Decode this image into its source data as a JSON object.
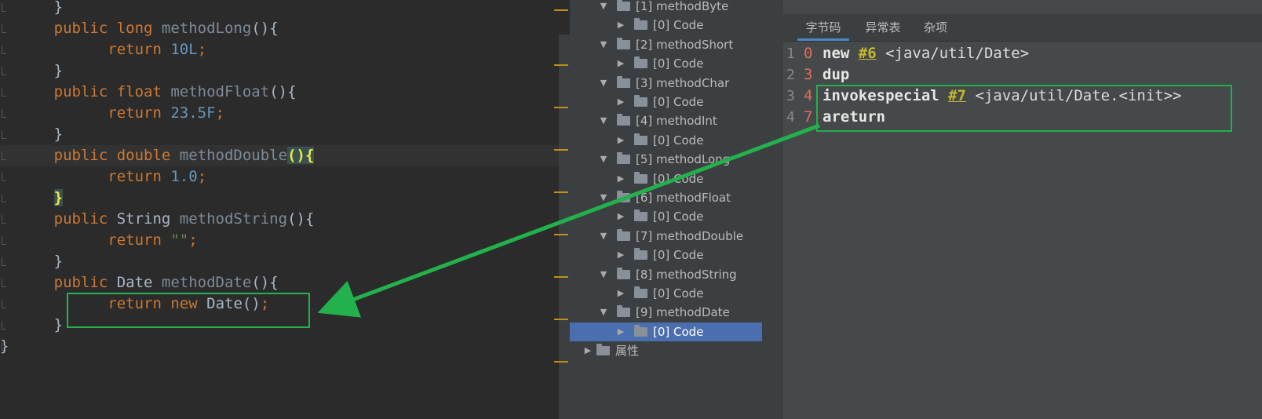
{
  "editor": {
    "lines": [
      {
        "id": "l1",
        "indent": "    ",
        "tokens": [
          {
            "t": "}",
            "c": ""
          }
        ]
      },
      {
        "id": "l2",
        "indent": "    ",
        "tokens": [
          {
            "t": "public long ",
            "c": "kw"
          },
          {
            "t": "methodLong",
            "c": "fn"
          },
          {
            "t": "(){",
            "c": ""
          }
        ]
      },
      {
        "id": "l3",
        "indent": "        ",
        "tokens": [
          {
            "t": "return ",
            "c": "kw"
          },
          {
            "t": "10L",
            "c": "num"
          },
          {
            "t": ";",
            "c": "kw"
          }
        ]
      },
      {
        "id": "l4",
        "indent": "    ",
        "tokens": [
          {
            "t": "}",
            "c": ""
          }
        ]
      },
      {
        "id": "l5",
        "indent": "    ",
        "tokens": [
          {
            "t": "public float ",
            "c": "kw"
          },
          {
            "t": "methodFloat",
            "c": "fn"
          },
          {
            "t": "(){",
            "c": ""
          }
        ]
      },
      {
        "id": "l6",
        "indent": "        ",
        "tokens": [
          {
            "t": "return ",
            "c": "kw"
          },
          {
            "t": "23.5F",
            "c": "num"
          },
          {
            "t": ";",
            "c": "kw"
          }
        ]
      },
      {
        "id": "l7",
        "indent": "    ",
        "tokens": [
          {
            "t": "}",
            "c": ""
          }
        ]
      },
      {
        "id": "l8",
        "indent": "    ",
        "tokens": [
          {
            "t": "public double ",
            "c": "kw"
          },
          {
            "t": "methodDouble",
            "c": "fn"
          },
          {
            "t": "()",
            "c": "br-hl"
          },
          {
            "t": "{",
            "c": "br-hl"
          }
        ],
        "current": true
      },
      {
        "id": "l9",
        "indent": "        ",
        "tokens": [
          {
            "t": "return ",
            "c": "kw"
          },
          {
            "t": "1.0",
            "c": "num"
          },
          {
            "t": ";",
            "c": "kw"
          }
        ]
      },
      {
        "id": "l10",
        "indent": "    ",
        "tokens": [
          {
            "t": "}",
            "c": "br-hl"
          }
        ]
      },
      {
        "id": "l11",
        "indent": "    ",
        "tokens": [
          {
            "t": "public ",
            "c": "kw"
          },
          {
            "t": "String ",
            "c": ""
          },
          {
            "t": "methodString",
            "c": "fn"
          },
          {
            "t": "(){",
            "c": ""
          }
        ]
      },
      {
        "id": "l12",
        "indent": "        ",
        "tokens": [
          {
            "t": "return ",
            "c": "kw"
          },
          {
            "t": "\"\"",
            "c": "str"
          },
          {
            "t": ";",
            "c": "kw"
          }
        ]
      },
      {
        "id": "l13",
        "indent": "    ",
        "tokens": [
          {
            "t": "}",
            "c": ""
          }
        ]
      },
      {
        "id": "l14",
        "indent": "    ",
        "tokens": [
          {
            "t": "public ",
            "c": "kw"
          },
          {
            "t": "Date ",
            "c": ""
          },
          {
            "t": "methodDate",
            "c": "fn"
          },
          {
            "t": "(){",
            "c": ""
          }
        ]
      },
      {
        "id": "l15",
        "indent": "        ",
        "tokens": [
          {
            "t": "return new ",
            "c": "kw"
          },
          {
            "t": "Date()",
            "c": ""
          },
          {
            "t": ";",
            "c": "kw"
          }
        ]
      },
      {
        "id": "l16",
        "indent": "    ",
        "tokens": [
          {
            "t": "}",
            "c": ""
          }
        ]
      },
      {
        "id": "l17",
        "indent": "",
        "tokens": [
          {
            "t": "}",
            "c": ""
          }
        ]
      }
    ]
  },
  "tree": {
    "items": [
      {
        "label": "[1] methodByte",
        "level": 1,
        "expanded": true
      },
      {
        "label": "[0] Code",
        "level": 2,
        "expanded": false
      },
      {
        "label": "[2] methodShort",
        "level": 1,
        "expanded": true
      },
      {
        "label": "[0] Code",
        "level": 2,
        "expanded": false
      },
      {
        "label": "[3] methodChar",
        "level": 1,
        "expanded": true
      },
      {
        "label": "[0] Code",
        "level": 2,
        "expanded": false
      },
      {
        "label": "[4] methodInt",
        "level": 1,
        "expanded": true
      },
      {
        "label": "[0] Code",
        "level": 2,
        "expanded": false
      },
      {
        "label": "[5] methodLong",
        "level": 1,
        "expanded": true
      },
      {
        "label": "[0] Code",
        "level": 2,
        "expanded": false
      },
      {
        "label": "[6] methodFloat",
        "level": 1,
        "expanded": true
      },
      {
        "label": "[0] Code",
        "level": 2,
        "expanded": false
      },
      {
        "label": "[7] methodDouble",
        "level": 1,
        "expanded": true
      },
      {
        "label": "[0] Code",
        "level": 2,
        "expanded": false
      },
      {
        "label": "[8] methodString",
        "level": 1,
        "expanded": true
      },
      {
        "label": "[0] Code",
        "level": 2,
        "expanded": false
      },
      {
        "label": "[9] methodDate",
        "level": 1,
        "expanded": true
      },
      {
        "label": "[0] Code",
        "level": 2,
        "expanded": false,
        "selected": true
      },
      {
        "label": "属性",
        "level": 0,
        "expanded": false
      }
    ]
  },
  "tabs": [
    "字节码",
    "异常表",
    "杂项"
  ],
  "bytecode": {
    "lines": [
      {
        "num": "1",
        "offset": "0",
        "op": "new",
        "ref": "#6",
        "rest": " <java/util/Date>"
      },
      {
        "num": "2",
        "offset": "3",
        "op": "dup",
        "ref": "",
        "rest": ""
      },
      {
        "num": "3",
        "offset": "4",
        "op": "invokespecial",
        "ref": "#7",
        "rest": " <java/util/Date.<init>>"
      },
      {
        "num": "4",
        "offset": "7",
        "op": "areturn",
        "ref": "",
        "rest": ""
      }
    ]
  },
  "colors": {
    "annotation": "#22b14c",
    "selection": "#4b6eaf",
    "keyword": "#cc7832",
    "number": "#6897bb"
  },
  "icons": {
    "folder": "folder-icon",
    "expanded": "triangle-down-icon",
    "collapsed": "triangle-right-icon"
  }
}
